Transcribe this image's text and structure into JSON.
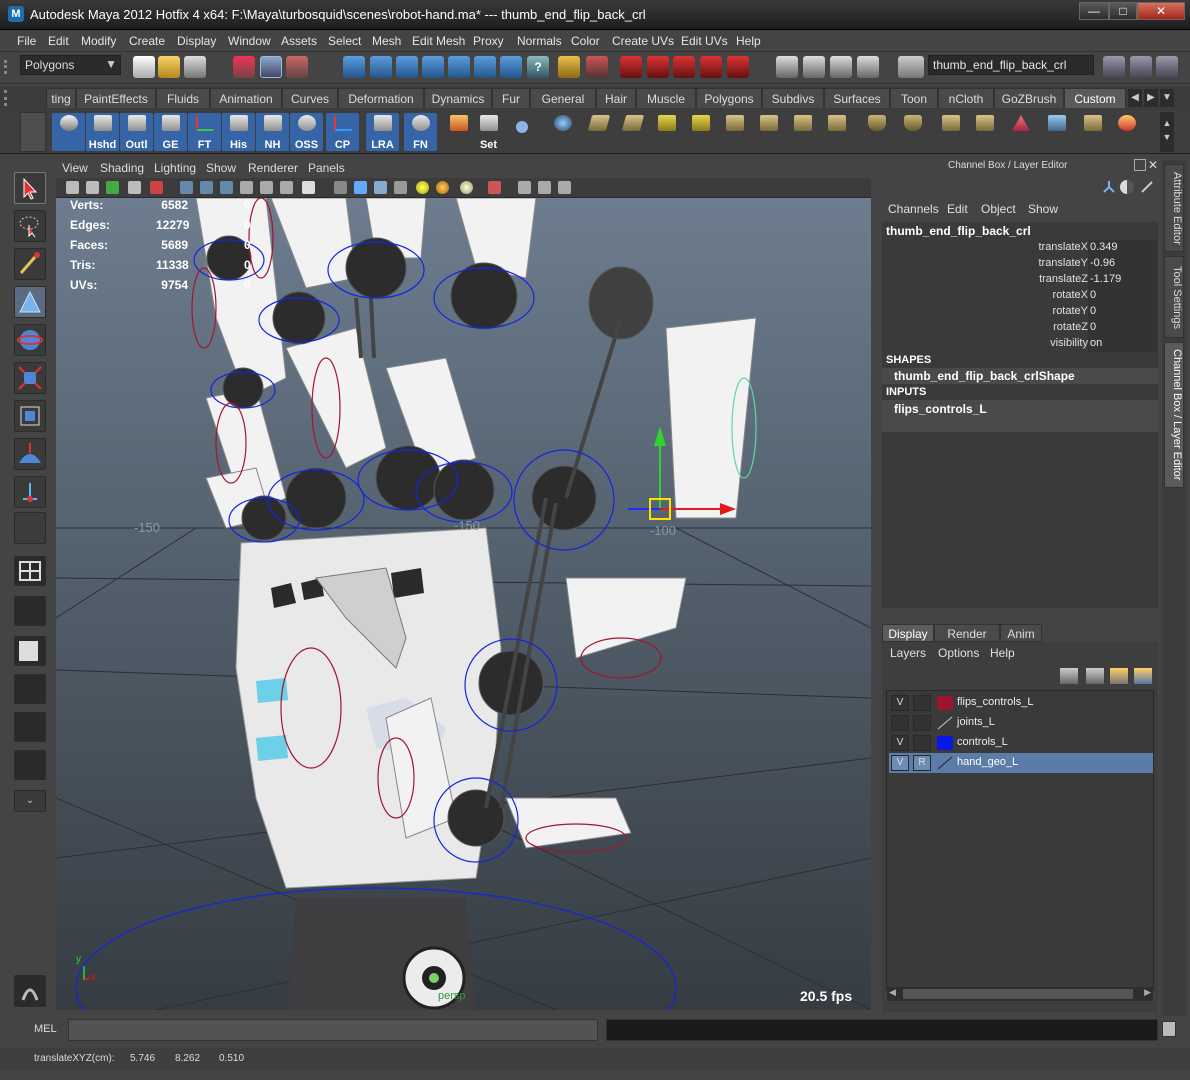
{
  "window": {
    "title": "Autodesk Maya 2012 Hotfix 4 x64: F:\\Maya\\turbosquid\\scenes\\robot-hand.ma*   ---   thumb_end_flip_back_crl",
    "app_icon": "M",
    "minimize": "—",
    "maximize": "□",
    "close": "✕"
  },
  "menu": [
    "File",
    "Edit",
    "Modify",
    "Create",
    "Display",
    "Window",
    "Assets",
    "Select",
    "Mesh",
    "Edit Mesh",
    "Proxy",
    "Normals",
    "Color",
    "Create UVs",
    "Edit UVs",
    "Help"
  ],
  "status": {
    "menu_set": "Polygons",
    "selection_field": "thumb_end_flip_back_crl"
  },
  "shelf_tabs": [
    "ting",
    "PaintEffects",
    "Fluids",
    "Animation",
    "Curves",
    "Deformation",
    "Dynamics",
    "Fur",
    "General",
    "Hair",
    "Muscle",
    "Polygons",
    "Subdivs",
    "Surfaces",
    "Toon",
    "nCloth",
    "GoZBrush",
    "Custom"
  ],
  "shelf_active_tab": "Custom",
  "shelf_buttons": [
    "Hshd",
    "Outl",
    "GE",
    "FT",
    "His",
    "NH",
    "OSS",
    "CP",
    "LRA",
    "FN",
    "Set"
  ],
  "viewport": {
    "menu": [
      "View",
      "Shading",
      "Lighting",
      "Show",
      "Renderer",
      "Panels"
    ],
    "hud": [
      {
        "label": "Verts:",
        "value": "6582",
        "extra": "0"
      },
      {
        "label": "Edges:",
        "value": "12279",
        "extra": "0"
      },
      {
        "label": "Faces:",
        "value": "5689",
        "extra": "0"
      },
      {
        "label": "Tris:",
        "value": "11338",
        "extra": "0"
      },
      {
        "label": "UVs:",
        "value": "9754",
        "extra": "0"
      }
    ],
    "grid_labels": [
      "-150",
      "-150",
      "-100"
    ],
    "fps": "20.5 fps",
    "persp_label": "persp",
    "axis_y": "y",
    "axis_x": "x"
  },
  "channel_box": {
    "header": "Channel Box / Layer Editor",
    "menu": [
      "Channels",
      "Edit",
      "Object",
      "Show"
    ],
    "object": "thumb_end_flip_back_crl",
    "attributes": [
      {
        "name": "translateX",
        "value": "0.349"
      },
      {
        "name": "translateY",
        "value": "-0.96"
      },
      {
        "name": "translateZ",
        "value": "-1.179"
      },
      {
        "name": "rotateX",
        "value": "0"
      },
      {
        "name": "rotateY",
        "value": "0"
      },
      {
        "name": "rotateZ",
        "value": "0"
      },
      {
        "name": "visibility",
        "value": "on"
      }
    ],
    "shapes_header": "SHAPES",
    "shape": "thumb_end_flip_back_crlShape",
    "inputs_header": "INPUTS",
    "input": "flips_controls_L"
  },
  "side_tabs": [
    "Attribute Editor",
    "Tool Settings",
    "Channel Box / Layer Editor"
  ],
  "layer_editor": {
    "tabs": [
      "Display",
      "Render",
      "Anim"
    ],
    "menu": [
      "Layers",
      "Options",
      "Help"
    ],
    "layers": [
      {
        "v": "V",
        "r": "",
        "name": "flips_controls_L",
        "color": "#9b1430"
      },
      {
        "v": "",
        "r": "",
        "name": "joints_L",
        "color": ""
      },
      {
        "v": "V",
        "r": "",
        "name": "controls_L",
        "color": "#0a18e6"
      },
      {
        "v": "V",
        "r": "R",
        "name": "hand_geo_L",
        "color": ""
      }
    ]
  },
  "command_line": {
    "label": "MEL"
  },
  "help_line": {
    "label": "translateXYZ(cm):",
    "x": "5.746",
    "y": "8.262",
    "z": "0.510"
  }
}
